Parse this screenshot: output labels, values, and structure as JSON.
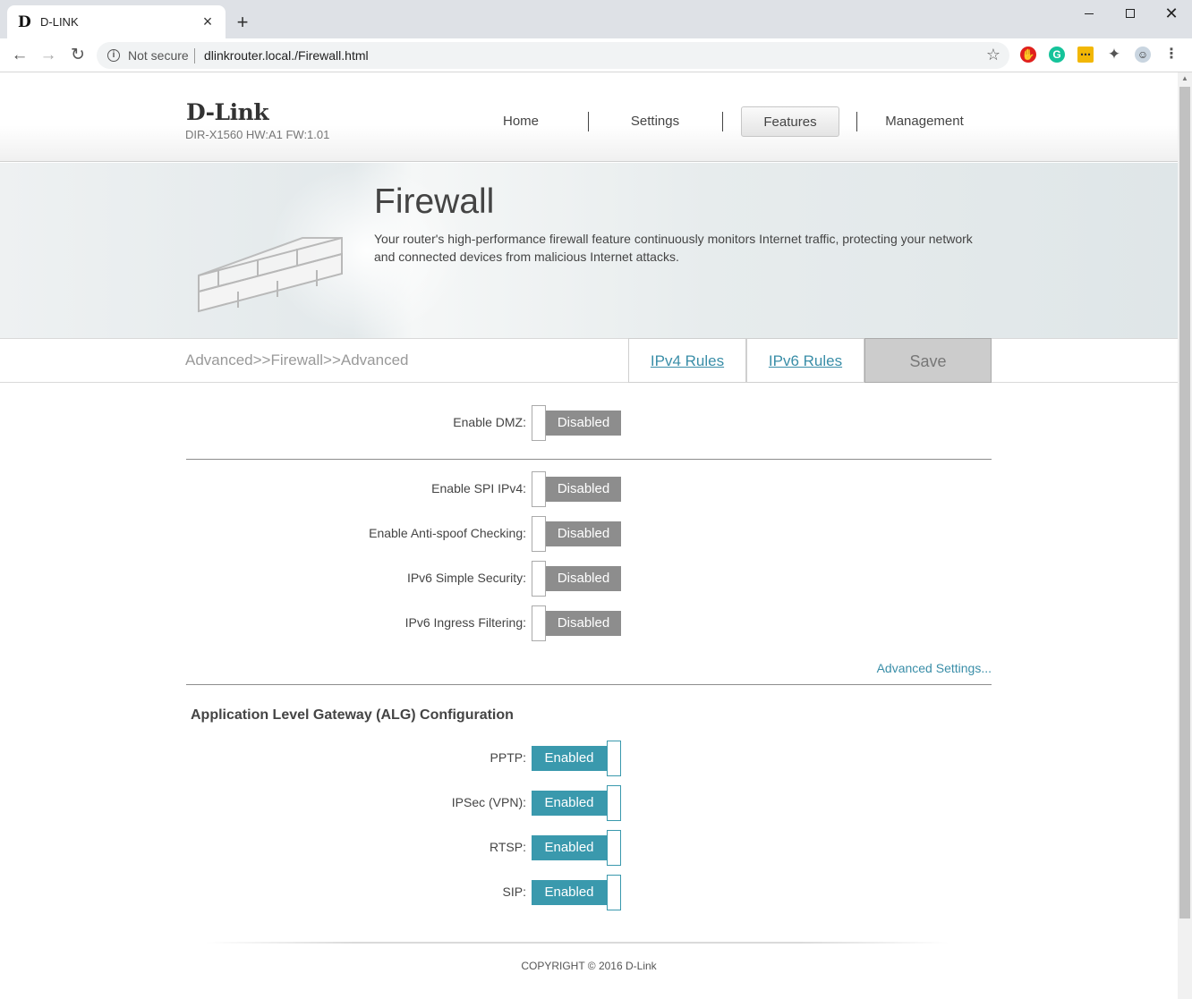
{
  "browser": {
    "tab_title": "D-LINK",
    "tab_favicon": "D",
    "close_glyph": "×",
    "new_tab_glyph": "+",
    "security_label": "Not secure",
    "url": "dlinkrouter.local./Firewall.html",
    "icons": [
      "back-icon",
      "forward-icon",
      "reload-icon",
      "info-icon",
      "star-icon",
      "adblock-icon",
      "grammarly-icon",
      "notes-icon",
      "extensions-icon",
      "profile-icon",
      "menu-icon"
    ]
  },
  "header": {
    "logo": "D-Link",
    "model": "DIR-X1560 HW:A1 FW:1.01",
    "menu": [
      {
        "label": "Home"
      },
      {
        "label": "Settings"
      },
      {
        "label": "Features",
        "active": true
      },
      {
        "label": "Management"
      }
    ]
  },
  "banner": {
    "title": "Firewall",
    "description": "Your router's high-performance firewall feature continuously monitors Internet traffic, protecting your network and connected devices from malicious Internet attacks."
  },
  "subbar": {
    "breadcrumb": "Advanced>>Firewall>>Advanced",
    "tabs": [
      {
        "label": "IPv4 Rules"
      },
      {
        "label": "IPv6 Rules"
      }
    ],
    "save_label": "Save"
  },
  "settings": {
    "dmz": {
      "label": "Enable DMZ:",
      "state": "Disabled"
    },
    "security": [
      {
        "label": "Enable SPI IPv4:",
        "state": "Disabled"
      },
      {
        "label": "Enable Anti-spoof Checking:",
        "state": "Disabled"
      },
      {
        "label": "IPv6 Simple Security:",
        "state": "Disabled"
      },
      {
        "label": "IPv6 Ingress Filtering:",
        "state": "Disabled"
      }
    ],
    "advanced_link": "Advanced Settings..."
  },
  "alg": {
    "title": "Application Level Gateway (ALG) Configuration",
    "items": [
      {
        "label": "PPTP:",
        "state": "Enabled"
      },
      {
        "label": "IPSec (VPN):",
        "state": "Enabled"
      },
      {
        "label": "RTSP:",
        "state": "Enabled"
      },
      {
        "label": "SIP:",
        "state": "Enabled"
      }
    ]
  },
  "footer": {
    "copyright": "COPYRIGHT © 2016 D-Link"
  },
  "colors": {
    "accent": "#3a99ad",
    "disabled": "#8d8d8d",
    "link": "#3a8ea8"
  }
}
